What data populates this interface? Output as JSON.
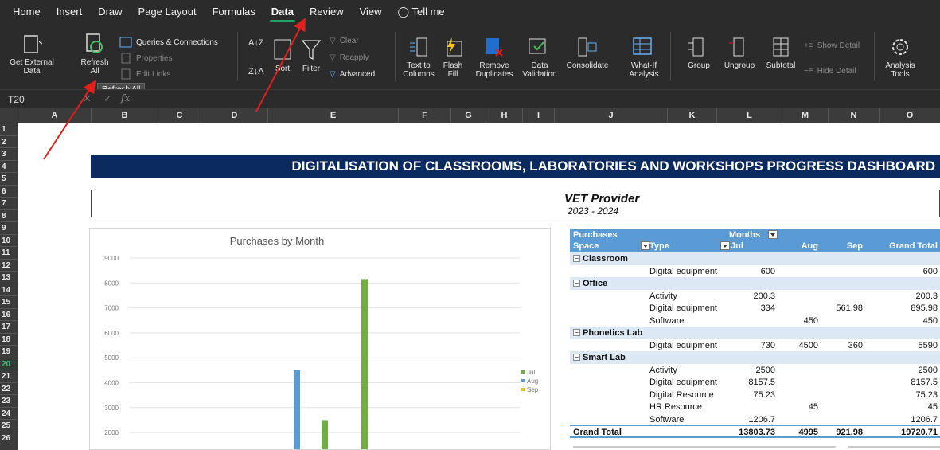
{
  "tabs": [
    "Home",
    "Insert",
    "Draw",
    "Page Layout",
    "Formulas",
    "Data",
    "Review",
    "View",
    "Tell me"
  ],
  "active_tab": "Data",
  "ribbon": {
    "get_external_data": "Get External Data",
    "refresh_all": "Refresh All",
    "queries_connections": "Queries & Connections",
    "properties": "Properties",
    "edit_links": "Edit Links",
    "sort": "Sort",
    "filter": "Filter",
    "clear": "Clear",
    "reapply": "Reapply",
    "advanced": "Advanced",
    "text_to_columns": "Text to Columns",
    "flash_fill": "Flash Fill",
    "remove_duplicates": "Remove Duplicates",
    "data_validation": "Data Validation",
    "consolidate": "Consolidate",
    "what_if": "What-If Analysis",
    "group": "Group",
    "ungroup": "Ungroup",
    "subtotal": "Subtotal",
    "show_detail": "Show Detail",
    "hide_detail": "Hide Detail",
    "analysis_tools": "Analysis Tools",
    "tooltip": "Refresh All"
  },
  "formula_bar": {
    "cell_ref": "T20",
    "fx": "fx"
  },
  "columns": [
    "A",
    "B",
    "C",
    "D",
    "E",
    "F",
    "G",
    "H",
    "I",
    "J",
    "K",
    "L",
    "M",
    "N",
    "O"
  ],
  "rows": [
    "1",
    "2",
    "3",
    "4",
    "5",
    "6",
    "7",
    "8",
    "9",
    "10",
    "11",
    "12",
    "13",
    "14",
    "15",
    "16",
    "17",
    "18",
    "19",
    "20",
    "21",
    "22",
    "23",
    "24",
    "25",
    "26"
  ],
  "selected_row": "20",
  "sheet": {
    "banner": "DIGITALISATION OF CLASSROOMS, LABORATORIES AND WORKSHOPS PROGRESS DASHBOARD",
    "provider": "VET Provider",
    "year": "2023 - 2024"
  },
  "chart_data": {
    "type": "bar",
    "title": "Purchases by Month",
    "ylim": [
      0,
      9000
    ],
    "yticks": [
      9000,
      8000,
      7000,
      6000,
      5000,
      4000,
      3000,
      2000
    ],
    "series": [
      {
        "name": "Jul",
        "color": "#70ad47"
      },
      {
        "name": "Aug",
        "color": "#5b9bd5"
      },
      {
        "name": "Sep",
        "color": "#ffc000"
      }
    ],
    "bars": [
      {
        "series": "Aug",
        "value": 4500
      },
      {
        "series": "Jul",
        "value": 2500
      },
      {
        "series": "Jul",
        "value": 8157.5
      }
    ]
  },
  "pivot": {
    "header1": {
      "a": "Purchases",
      "months": "Months"
    },
    "header2": {
      "space": "Space",
      "type": "Type",
      "jul": "Jul",
      "aug": "Aug",
      "sep": "Sep",
      "total": "Grand Total"
    },
    "rows": [
      {
        "kind": "group",
        "space": "Classroom",
        "type": "",
        "jul": "",
        "aug": "",
        "sep": "",
        "total": ""
      },
      {
        "kind": "item",
        "space": "",
        "type": "Digital equipment",
        "jul": "600",
        "aug": "",
        "sep": "",
        "total": "600"
      },
      {
        "kind": "group",
        "space": "Office",
        "type": "",
        "jul": "",
        "aug": "",
        "sep": "",
        "total": ""
      },
      {
        "kind": "item",
        "space": "",
        "type": "Activity",
        "jul": "200.3",
        "aug": "",
        "sep": "",
        "total": "200.3"
      },
      {
        "kind": "item",
        "space": "",
        "type": "Digital equipment",
        "jul": "334",
        "aug": "",
        "sep": "561.98",
        "total": "895.98"
      },
      {
        "kind": "item",
        "space": "",
        "type": "Software",
        "jul": "",
        "aug": "450",
        "sep": "",
        "total": "450"
      },
      {
        "kind": "group",
        "space": "Phonetics Lab",
        "type": "",
        "jul": "",
        "aug": "",
        "sep": "",
        "total": ""
      },
      {
        "kind": "item",
        "space": "",
        "type": "Digital equipment",
        "jul": "730",
        "aug": "4500",
        "sep": "360",
        "total": "5590"
      },
      {
        "kind": "group",
        "space": "Smart Lab",
        "type": "",
        "jul": "",
        "aug": "",
        "sep": "",
        "total": ""
      },
      {
        "kind": "item",
        "space": "",
        "type": "Activity",
        "jul": "2500",
        "aug": "",
        "sep": "",
        "total": "2500"
      },
      {
        "kind": "item",
        "space": "",
        "type": "Digital equipment",
        "jul": "8157.5",
        "aug": "",
        "sep": "",
        "total": "8157.5"
      },
      {
        "kind": "item",
        "space": "",
        "type": "Digital Resource",
        "jul": "75.23",
        "aug": "",
        "sep": "",
        "total": "75.23"
      },
      {
        "kind": "item",
        "space": "",
        "type": "HR Resource",
        "jul": "",
        "aug": "45",
        "sep": "",
        "total": "45"
      },
      {
        "kind": "item",
        "space": "",
        "type": "Software",
        "jul": "1206.7",
        "aug": "",
        "sep": "",
        "total": "1206.7"
      }
    ],
    "grand_total": {
      "label": "Grand Total",
      "jul": "13803.73",
      "aug": "4995",
      "sep": "921.98",
      "total": "19720.71"
    }
  },
  "colors": {
    "ribbon_bg": "#2b2b2b",
    "banner": "#0b2a5e",
    "pivot_header": "#5b9bd5",
    "pivot_band": "#dde8f5",
    "annotation_arrow": "#e0201c"
  }
}
